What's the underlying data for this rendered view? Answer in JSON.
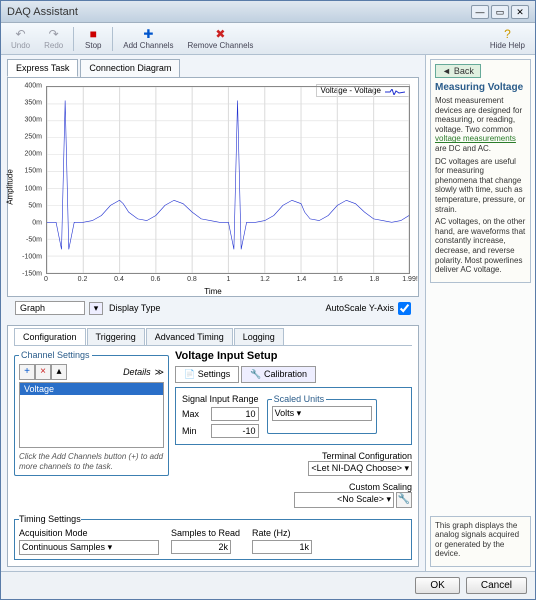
{
  "window": {
    "title": "DAQ Assistant"
  },
  "toolbar": {
    "undo": "Undo",
    "redo": "Redo",
    "stop": "Stop",
    "add_channels": "Add Channels",
    "remove_channels": "Remove Channels",
    "hide_help": "Hide Help"
  },
  "view_tabs": {
    "express": "Express Task",
    "conn": "Connection Diagram"
  },
  "legend": "Voltage - Voltage",
  "yaxis": "Amplitude",
  "xaxis": "Time",
  "below": {
    "display_type": "Graph",
    "display_type_label": "Display Type",
    "autoscale_label": "AutoScale Y-Axis",
    "autoscale_checked": true
  },
  "cfg_tabs": {
    "configuration": "Configuration",
    "triggering": "Triggering",
    "advanced": "Advanced Timing",
    "logging": "Logging"
  },
  "channel_settings": {
    "title": "Channel Settings",
    "details": "Details",
    "channel": "Voltage",
    "hint": "Click the Add Channels button (+) to add more channels to the task."
  },
  "vsetup": {
    "title": "Voltage Input Setup",
    "tab_settings": "Settings",
    "tab_calibration": "Calibration",
    "range_title": "Signal Input Range",
    "max_label": "Max",
    "max_value": "10",
    "min_label": "Min",
    "min_value": "-10",
    "scaled_units_title": "Scaled Units",
    "scaled_units": "Volts",
    "terminal_cfg_label": "Terminal Configuration",
    "terminal_cfg": "<Let NI-DAQ Choose>",
    "custom_scaling_label": "Custom Scaling",
    "custom_scaling": "<No Scale>"
  },
  "timing": {
    "title": "Timing Settings",
    "mode_label": "Acquisition Mode",
    "mode": "Continuous Samples",
    "samples_label": "Samples to Read",
    "samples": "2k",
    "rate_label": "Rate (Hz)",
    "rate": "1k"
  },
  "help": {
    "back": "Back",
    "title": "Measuring Voltage",
    "p1": "Most measurement devices are designed for measuring, or reading, voltage. Two common",
    "link": "voltage measurements",
    "p1b": "are DC and AC.",
    "p2": "DC voltages are useful for measuring phenomena that change slowly with time, such as temperature, pressure, or strain.",
    "p3": "AC voltages, on the other hand, are waveforms that constantly increase, decrease, and reverse polarity. Most powerlines deliver AC voltage.",
    "lower": "This graph displays the analog signals acquired or generated by the device."
  },
  "footer": {
    "ok": "OK",
    "cancel": "Cancel"
  },
  "chart_data": {
    "type": "line",
    "xlabel": "Time",
    "ylabel": "Amplitude",
    "xlim": [
      0,
      1.995
    ],
    "ylim": [
      -150,
      400
    ],
    "yticks": [
      400,
      350,
      300,
      250,
      200,
      150,
      100,
      50,
      0,
      -50,
      -100,
      -150
    ],
    "xticks": [
      0,
      0.2,
      0.4,
      0.6,
      0.8,
      1,
      1.2,
      1.4,
      1.6,
      1.8,
      1.995
    ],
    "series": [
      {
        "name": "Voltage - Voltage",
        "color": "#2030d0",
        "x": [
          0,
          0.05,
          0.08,
          0.1,
          0.12,
          0.15,
          0.2,
          0.25,
          0.3,
          0.35,
          0.4,
          0.42,
          0.45,
          0.5,
          0.55,
          0.6,
          0.65,
          0.7,
          0.75,
          0.8,
          0.85,
          0.9,
          0.95,
          1.0,
          1.03,
          1.05,
          1.07,
          1.1,
          1.15,
          1.2,
          1.25,
          1.3,
          1.35,
          1.4,
          1.42,
          1.45,
          1.5,
          1.55,
          1.6,
          1.65,
          1.7,
          1.75,
          1.8,
          1.85,
          1.9,
          1.95,
          1.995
        ],
        "y": [
          0,
          0,
          -80,
          360,
          -80,
          0,
          0,
          5,
          20,
          50,
          65,
          55,
          30,
          10,
          5,
          20,
          50,
          65,
          55,
          30,
          10,
          5,
          0,
          0,
          -80,
          360,
          -80,
          0,
          0,
          5,
          20,
          50,
          65,
          55,
          30,
          10,
          5,
          20,
          50,
          65,
          55,
          30,
          10,
          5,
          0,
          5,
          20
        ]
      }
    ]
  }
}
